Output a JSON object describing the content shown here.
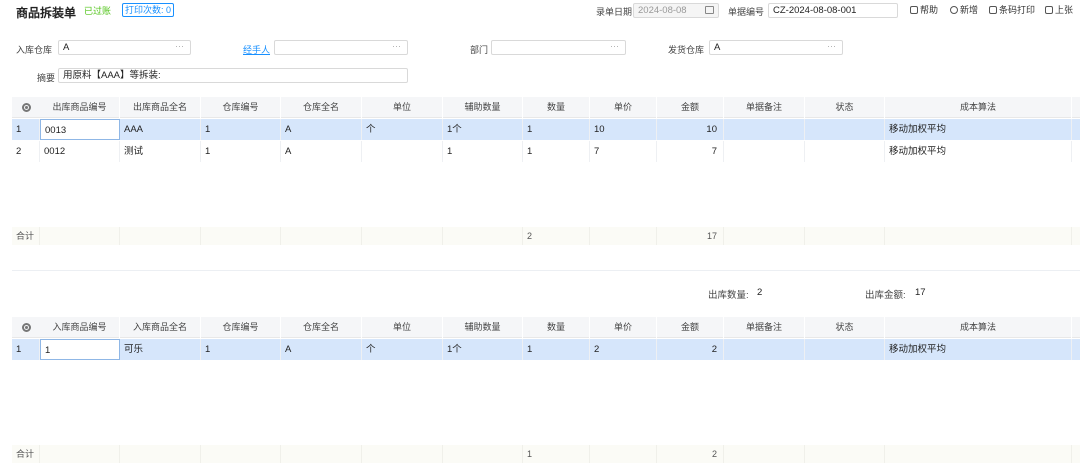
{
  "header": {
    "title": "商品拆装单",
    "status": "已过账",
    "print_count": "打印次数: 0",
    "date_label": "录单日期",
    "date_value": "2024-08-08",
    "docno_label": "单据编号",
    "docno_value": "CZ-2024-08-08-001",
    "toolbar": {
      "help": "帮助",
      "new": "新增",
      "barcode_print": "条码打印",
      "prev": "上张"
    }
  },
  "form": {
    "in_warehouse_label": "入库仓库",
    "in_warehouse_value": "A",
    "handler_label": "经手人",
    "handler_value": "",
    "dept_label": "部门",
    "dept_value": "",
    "out_warehouse_label": "发货仓库",
    "out_warehouse_value": "A",
    "summary_label": "摘要",
    "summary_value": "用原料【AAA】等拆装:"
  },
  "out_table": {
    "headers": [
      "出库商品编号",
      "出库商品全名",
      "仓库编号",
      "仓库全名",
      "单位",
      "辅助数量",
      "数量",
      "单价",
      "金额",
      "单据备注",
      "状态",
      "成本算法"
    ],
    "rows": [
      {
        "idx": "1",
        "code": "0013",
        "name": "AAA",
        "wh_code": "1",
        "wh_name": "A",
        "unit": "个",
        "aux_qty": "1个",
        "qty": "1",
        "price": "10",
        "amount": "10",
        "remark": "",
        "state": "",
        "cost": "移动加权平均"
      },
      {
        "idx": "2",
        "code": "0012",
        "name": "测试",
        "wh_code": "1",
        "wh_name": "A",
        "unit": "",
        "aux_qty": "1",
        "qty": "1",
        "price": "7",
        "amount": "7",
        "remark": "",
        "state": "",
        "cost": "移动加权平均"
      }
    ],
    "footer": {
      "label": "合计",
      "qty": "2",
      "amount": "17"
    }
  },
  "out_summary": {
    "qty_label": "出库数量:",
    "qty_value": "2",
    "amount_label": "出库金额:",
    "amount_value": "17"
  },
  "in_table": {
    "headers": [
      "入库商品编号",
      "入库商品全名",
      "仓库编号",
      "仓库全名",
      "单位",
      "辅助数量",
      "数量",
      "单价",
      "金额",
      "单据备注",
      "状态",
      "成本算法"
    ],
    "rows": [
      {
        "idx": "1",
        "code": "1",
        "name": "可乐",
        "wh_code": "1",
        "wh_name": "A",
        "unit": "个",
        "aux_qty": "1个",
        "qty": "1",
        "price": "2",
        "amount": "2",
        "remark": "",
        "state": "",
        "cost": "移动加权平均"
      }
    ],
    "footer": {
      "label": "合计",
      "qty": "1",
      "amount": "2"
    }
  }
}
